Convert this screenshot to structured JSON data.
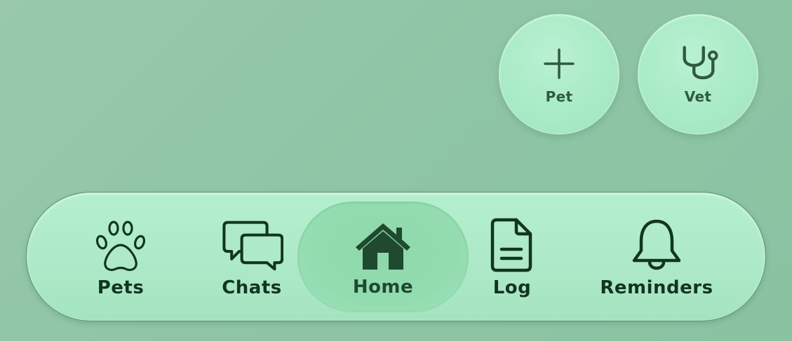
{
  "quick_actions": [
    {
      "label": "Pet",
      "icon": "plus-icon"
    },
    {
      "label": "Vet",
      "icon": "stethoscope-icon"
    }
  ],
  "tabbar": {
    "selected": "Home",
    "tabs": [
      {
        "label": "Pets",
        "icon": "paw-icon"
      },
      {
        "label": "Chats",
        "icon": "chat-bubbles-icon"
      },
      {
        "label": "Home",
        "icon": "house-icon"
      },
      {
        "label": "Log",
        "icon": "document-icon"
      },
      {
        "label": "Reminders",
        "icon": "bell-icon"
      }
    ]
  },
  "colors": {
    "background": "#8fc5a6",
    "tabbar": "#aeeac9",
    "selected_tab": "#93dcb0",
    "icon": "#123522",
    "home_icon": "#1f4a2f"
  }
}
